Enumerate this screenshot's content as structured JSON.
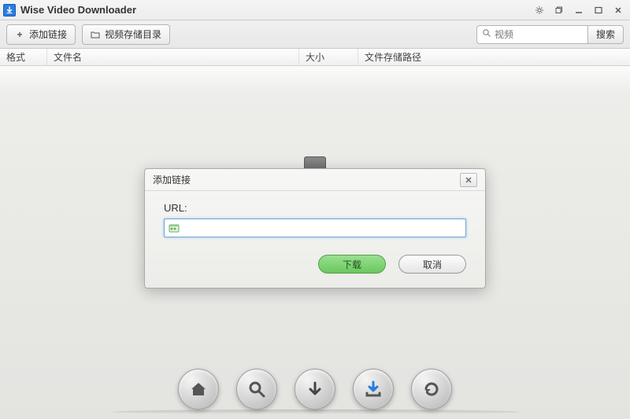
{
  "app": {
    "title": "Wise Video Downloader"
  },
  "toolbar": {
    "add_link_label": "添加链接",
    "storage_dir_label": "视频存储目录",
    "search_placeholder": "视频",
    "search_button_label": "搜索"
  },
  "columns": {
    "format": "格式",
    "filename": "文件名",
    "size": "大小",
    "path": "文件存储路径"
  },
  "dialog": {
    "title": "添加链接",
    "url_label": "URL:",
    "url_value": "",
    "download_label": "下载",
    "cancel_label": "取消"
  },
  "bottom_nav": {
    "home": "home",
    "search": "search",
    "download_arrow": "download-arrow",
    "save_download": "save-download",
    "refresh": "refresh"
  }
}
